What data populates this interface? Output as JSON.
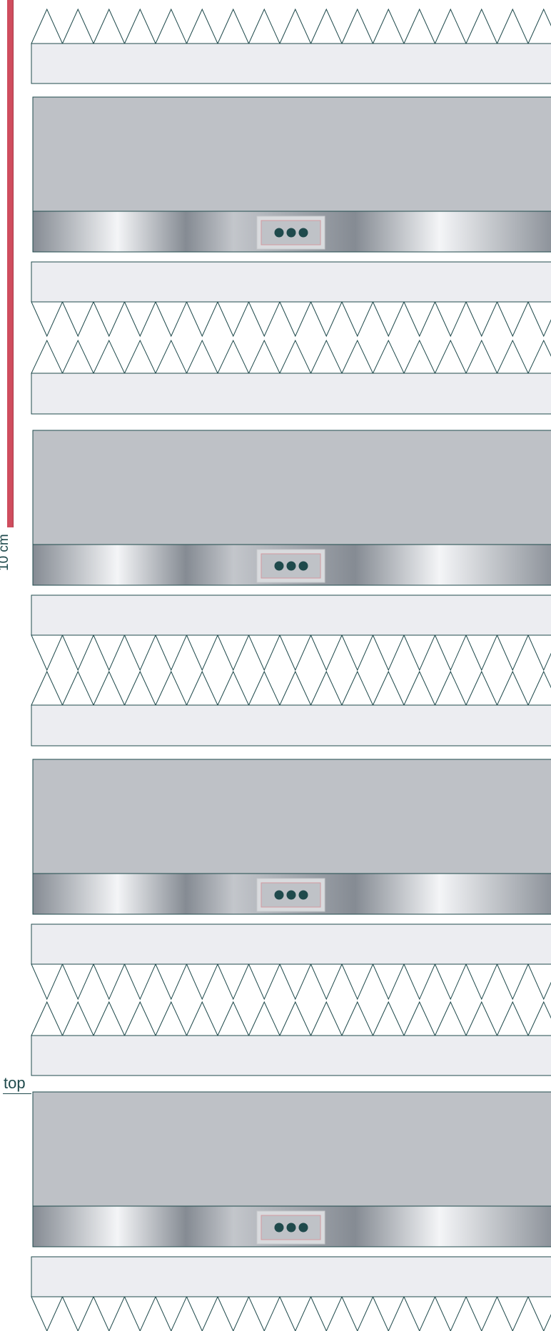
{
  "diagram": {
    "scale_label": "10 cm",
    "top_label": "top",
    "colors": {
      "outline": "#1f4a4c",
      "gap_fill": "#ecedf1",
      "panel_fill": "#bec1c6",
      "scale_bar": "#cf4d5e",
      "bezel_light": "#f4f5f7",
      "bezel_dark": "#858b93",
      "dot": "#1f4a4c"
    },
    "icons": {
      "control_dots": "three-dots-icon",
      "teeth": "triangle-teeth-pattern"
    },
    "module_count": 4
  }
}
